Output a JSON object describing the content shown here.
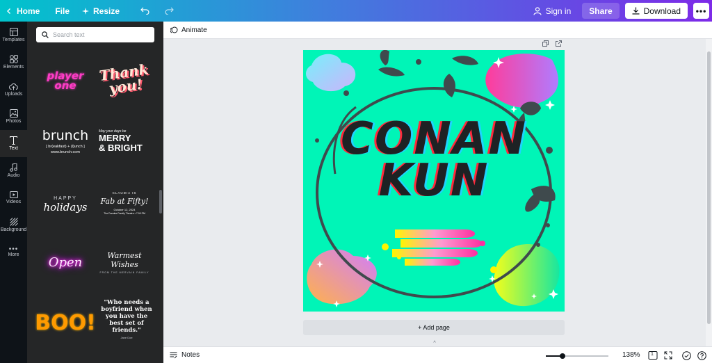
{
  "topbar": {
    "home_label": "Home",
    "file_label": "File",
    "resize_label": "Resize",
    "signin_label": "Sign in",
    "share_label": "Share",
    "download_label": "Download"
  },
  "rail": {
    "items": [
      {
        "label": "Templates",
        "icon": "templates-icon"
      },
      {
        "label": "Elements",
        "icon": "elements-icon"
      },
      {
        "label": "Uploads",
        "icon": "uploads-icon"
      },
      {
        "label": "Photos",
        "icon": "photos-icon"
      },
      {
        "label": "Text",
        "icon": "text-icon"
      },
      {
        "label": "Audio",
        "icon": "audio-icon"
      },
      {
        "label": "Videos",
        "icon": "videos-icon"
      },
      {
        "label": "Background",
        "icon": "background-icon"
      },
      {
        "label": "More",
        "icon": "more-icon"
      }
    ],
    "active": "Text"
  },
  "panel": {
    "search_placeholder": "Search text",
    "tiles": {
      "player_one": [
        "player",
        "one"
      ],
      "thank_you": [
        "Thank",
        "you!"
      ],
      "brunch": {
        "title": "brunch",
        "line1": "[ br(eakfast) + (l)unch ]",
        "line2": "www.brunch.com"
      },
      "merry": {
        "small": "May your days be",
        "line1": "MERRY",
        "line2": "& BRIGHT"
      },
      "holidays": {
        "small": "HAPPY",
        "big": "holidays"
      },
      "fab": {
        "small": "CLAUDIA IS",
        "big": "Fab at Fifty!",
        "line1": "October 12, 2024",
        "line2": "The Dundee Family Theatre • 7:00 PM"
      },
      "open": "Open",
      "warmest": {
        "big": "Warmest Wishes",
        "small": "FROM THE MERVAIN FAMILY"
      },
      "boo": "BOO!",
      "quote": {
        "text": "\"Who needs a boyfriend when you have the best set of friends.\"",
        "author": "Jane Doe"
      }
    }
  },
  "subbar": {
    "animate_label": "Animate"
  },
  "design": {
    "title_line1": "CONAN",
    "title_line2": "KUN",
    "bg_color": "#00f5b7"
  },
  "canvas": {
    "add_page_label": "+ Add page"
  },
  "bottombar": {
    "notes_label": "Notes",
    "zoom_label": "138%",
    "zoom_fraction": 0.27,
    "page_count": "1"
  }
}
